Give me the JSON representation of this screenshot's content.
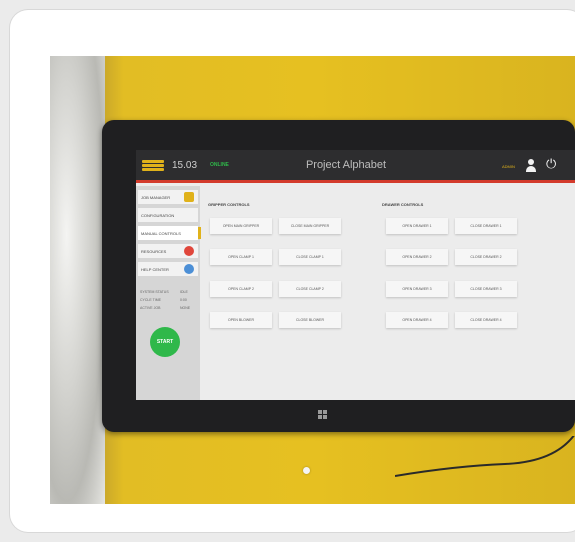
{
  "topbar": {
    "version": "15.03",
    "status": "ONLINE",
    "title": "Project Alphabet",
    "user_label": "ADMIN"
  },
  "sidebar": {
    "items": [
      {
        "label": "JOB MANAGER"
      },
      {
        "label": "CONFIGURATION"
      },
      {
        "label": "MANUAL CONTROLS"
      },
      {
        "label": "RESOURCES"
      },
      {
        "label": "HELP CENTER"
      }
    ],
    "stats": [
      {
        "key": "SYSTEM STATUS",
        "value": "IDLE"
      },
      {
        "key": "CYCLE TIME",
        "value": "0:00"
      },
      {
        "key": "ACTIVE JOB",
        "value": "NONE"
      }
    ],
    "go_label": "START"
  },
  "main": {
    "left_section": {
      "title": "GRIPPER CONTROLS",
      "buttons": [
        {
          "label": "OPEN MAIN GRIPPER"
        },
        {
          "label": "CLOSE MAIN GRIPPER"
        },
        {
          "label": "OPEN CLAMP 1"
        },
        {
          "label": "CLOSE CLAMP 1"
        },
        {
          "label": "OPEN CLAMP 2"
        },
        {
          "label": "CLOSE CLAMP 2"
        },
        {
          "label": "OPEN BLOWER"
        },
        {
          "label": "CLOSE BLOWER"
        }
      ]
    },
    "right_section": {
      "title": "DRAWER CONTROLS",
      "buttons": [
        {
          "label": "OPEN DRAWER 1"
        },
        {
          "label": "CLOSE DRAWER 1"
        },
        {
          "label": "OPEN DRAWER 2"
        },
        {
          "label": "CLOSE DRAWER 2"
        },
        {
          "label": "OPEN DRAWER 3"
        },
        {
          "label": "CLOSE DRAWER 3"
        },
        {
          "label": "OPEN DRAWER 4"
        },
        {
          "label": "CLOSE DRAWER 4"
        }
      ]
    }
  },
  "colors": {
    "accent_red": "#d33b2c",
    "accent_yellow": "#e0b21b",
    "status_green": "#2fb84a",
    "dot_red": "#e0463b",
    "dot_blue": "#4c8fd6"
  },
  "icons": [
    "logo-icon",
    "user-icon",
    "power-icon",
    "windows-icon"
  ]
}
